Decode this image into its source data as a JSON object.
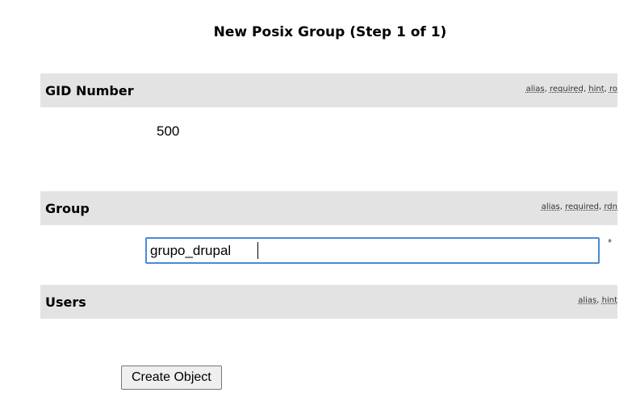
{
  "form": {
    "title": "New Posix Group (Step 1 of 1)",
    "submit_label": "Create Object"
  },
  "sections": [
    {
      "label": "GID Number",
      "hints": [
        "alias",
        "required",
        "hint",
        "ro"
      ],
      "value": "500"
    },
    {
      "label": "Group",
      "hints": [
        "alias",
        "required",
        "rdn"
      ],
      "value": "grupo_drupal",
      "required_marker": "*"
    },
    {
      "label": "Users",
      "hints": [
        "alias",
        "hint"
      ]
    }
  ],
  "colors": {
    "section_bar": "#e3e3e3",
    "input_focus_border": "#4a89dc"
  }
}
